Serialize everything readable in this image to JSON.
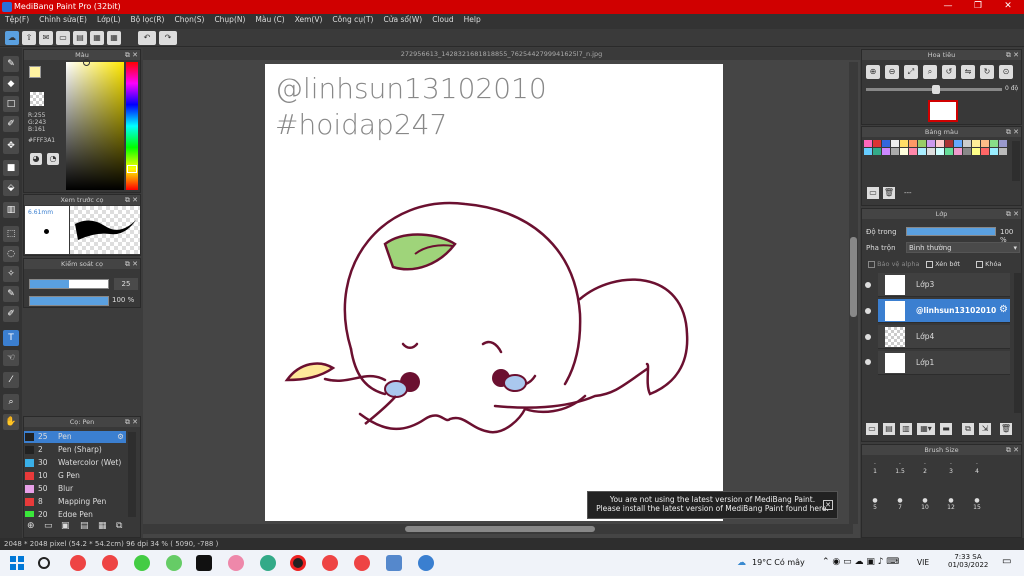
{
  "window": {
    "title": "MediBang Paint Pro (32bit)",
    "minimize": "—",
    "maximize": "❐",
    "close": "✕"
  },
  "menu": [
    "Tệp(F)",
    "Chỉnh sửa(E)",
    "Lớp(L)",
    "Bộ lọc(R)",
    "Chọn(S)",
    "Chụp(N)",
    "Màu (C)",
    "Xem(V)",
    "Công cụ(T)",
    "Cửa sổ(W)",
    "Cloud",
    "Help"
  ],
  "color_panel": {
    "title": "Màu",
    "r": "R:255",
    "g": "G:243",
    "b": "B:161",
    "hex": "#FFF3A1"
  },
  "brush_preview": {
    "title": "Xem trước cọ",
    "size": "6.61mm"
  },
  "brush_control": {
    "title": "Kiểm soát cọ",
    "size": "25",
    "opacity": "100 %",
    "size_fill": 0.5,
    "opacity_fill": 1.0
  },
  "brush_list": {
    "title": "Cọ: Pen",
    "items": [
      {
        "num": "25",
        "label": "Pen",
        "color": "#222222"
      },
      {
        "num": "2",
        "label": "Pen (Sharp)",
        "color": "#222222"
      },
      {
        "num": "30",
        "label": "Watercolor (Wet)",
        "color": "#3ab0e8"
      },
      {
        "num": "10",
        "label": "G Pen",
        "color": "#e83a3a"
      },
      {
        "num": "50",
        "label": "Blur",
        "color": "#e8a0e8"
      },
      {
        "num": "8",
        "label": "Mapping Pen",
        "color": "#e83a3a"
      },
      {
        "num": "20",
        "label": "Edge Pen",
        "color": "#3ae83a"
      }
    ]
  },
  "document": {
    "title": "272956613_1428321681818855_7625442799941625l7_n.jpg"
  },
  "canvas_text": {
    "line1": "@linhsun13102010",
    "line2": "#hoidap247"
  },
  "navigator": {
    "title": "Hoa tiêu",
    "angle": "0 độ"
  },
  "palette": {
    "title": "Bảng màu",
    "dash": "---"
  },
  "layer_panel": {
    "title": "Lớp",
    "opacity_label": "Độ trong",
    "opacity_value": "100 %",
    "blend_label": "Pha trộn",
    "blend_value": "Bình thường",
    "protect_alpha": "Bảo vệ alpha",
    "clip": "Xén bớt",
    "lock": "Khóa",
    "layers": [
      {
        "name": "Lớp3",
        "selected": false
      },
      {
        "name": "@linhsun13102010",
        "selected": true
      },
      {
        "name": "Lớp4",
        "selected": false
      },
      {
        "name": "Lớp1",
        "selected": false
      }
    ]
  },
  "brush_size": {
    "title": "Brush Size",
    "values": [
      "1",
      "1.5",
      "2",
      "3",
      "4",
      "5",
      "7",
      "10",
      "12",
      "15"
    ]
  },
  "notification": {
    "line1": "You are not using the latest version of MediBang Paint.",
    "line2": "Please install the latest version of MediBang Paint found here."
  },
  "status": {
    "text": "2048 * 2048 pixel   (54.2 * 54.2cm)   96 dpi   34 %   ( 5090, -788 )"
  },
  "taskbar": {
    "weather": "19°C  Có mây",
    "lang": "VIE",
    "time": "7:33 SA",
    "date": "01/03/2022"
  }
}
